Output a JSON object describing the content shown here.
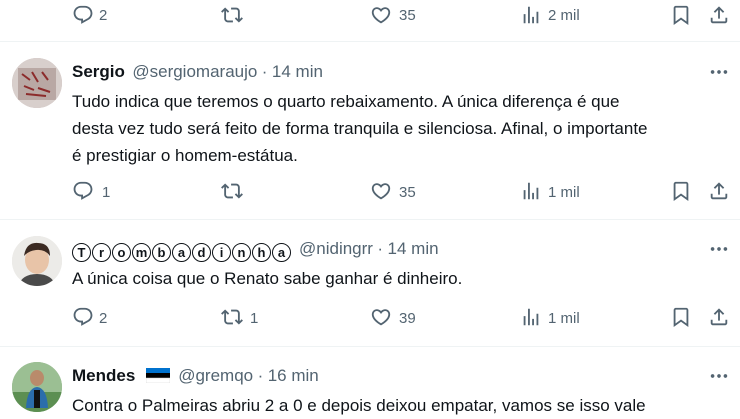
{
  "tweets": [
    {
      "stats": {
        "replies": "2",
        "retweets": "",
        "likes": "35",
        "views": "2 mil"
      }
    },
    {
      "name": "Sergio",
      "handle": "@sergiomaraujo",
      "time": "14 min",
      "lines": [
        "Tudo indica que teremos o quarto rebaixamento. A única diferença é que",
        "desta vez tudo será feito de forma tranquila e silenciosa. Afinal, o importante",
        "é prestigiar o homem-estátua."
      ],
      "stats": {
        "replies": "1",
        "retweets": "",
        "likes": "35",
        "views": "1 mil"
      }
    },
    {
      "name_letters": [
        "T",
        "r",
        "o",
        "m",
        "b",
        "a",
        "d",
        "i",
        "n",
        "h",
        "a"
      ],
      "handle": "@nidingrr",
      "time": "14 min",
      "lines": [
        "A única coisa que o Renato sabe ganhar é dinheiro."
      ],
      "stats": {
        "replies": "2",
        "retweets": "1",
        "likes": "39",
        "views": "1 mil"
      }
    },
    {
      "name": "Mendes",
      "handle": "@gremqo",
      "time": "16 min",
      "lines": [
        "Contra o Palmeiras abriu 2 a 0 e depois deixou empatar, vamos se isso vale"
      ]
    }
  ],
  "separator": "·",
  "colors": {
    "text": "#0f1419",
    "muted": "#536471",
    "divider": "#eff3f4"
  },
  "icons": [
    "reply-icon",
    "retweet-icon",
    "like-icon",
    "views-icon",
    "bookmark-icon",
    "share-icon",
    "more-icon"
  ]
}
